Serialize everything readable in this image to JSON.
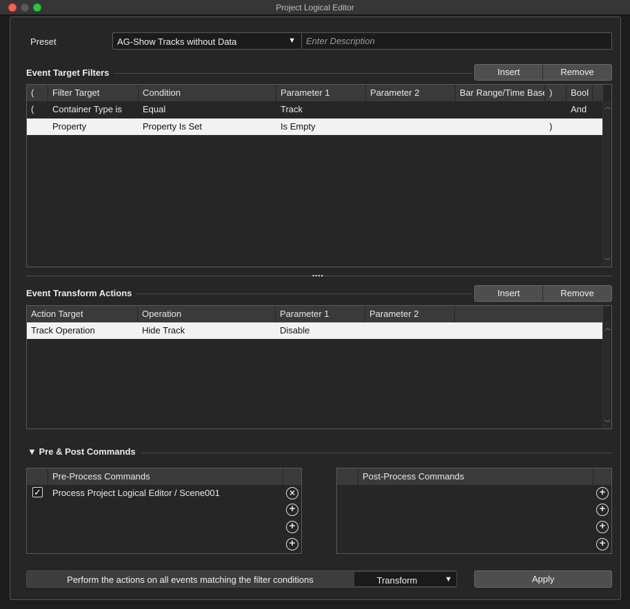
{
  "window": {
    "title": "Project Logical Editor"
  },
  "preset": {
    "label": "Preset",
    "value": "AG-Show Tracks without Data",
    "description_placeholder": "Enter Description"
  },
  "filters": {
    "title": "Event Target Filters",
    "insert_label": "Insert",
    "remove_label": "Remove",
    "columns": [
      "(",
      "Filter Target",
      "Condition",
      "Parameter 1",
      "Parameter 2",
      "Bar Range/Time Base",
      ")",
      "Bool"
    ],
    "rows": [
      {
        "open": "(",
        "target": "Container Type is",
        "condition": "Equal",
        "param1": "Track",
        "param2": "",
        "range": "",
        "close": "",
        "bool": "And",
        "selected": false
      },
      {
        "open": "",
        "target": "Property",
        "condition": "Property Is Set",
        "param1": "Is Empty",
        "param2": "",
        "range": "",
        "close": ")",
        "bool": "",
        "selected": true
      }
    ]
  },
  "actions": {
    "title": "Event Transform Actions",
    "insert_label": "Insert",
    "remove_label": "Remove",
    "columns": [
      "Action Target",
      "Operation",
      "Parameter 1",
      "Parameter 2"
    ],
    "rows": [
      {
        "target": "Track Operation",
        "operation": "Hide Track",
        "param1": "Disable",
        "param2": "",
        "selected": true
      }
    ]
  },
  "commands": {
    "title": "Pre & Post Commands",
    "pre_header": "Pre-Process Commands",
    "post_header": "Post-Process Commands",
    "pre_items": [
      {
        "checked": true,
        "label": "Process Project Logical Editor / Scene001"
      }
    ]
  },
  "footer": {
    "text": "Perform the actions on all events matching the filter conditions",
    "mode": "Transform",
    "apply_label": "Apply"
  },
  "icons": {
    "dropdown": "chevron-down-icon",
    "remove_command": "circle-x-icon",
    "add_command": "circle-plus-icon",
    "disclosure": "triangle-down-icon"
  }
}
